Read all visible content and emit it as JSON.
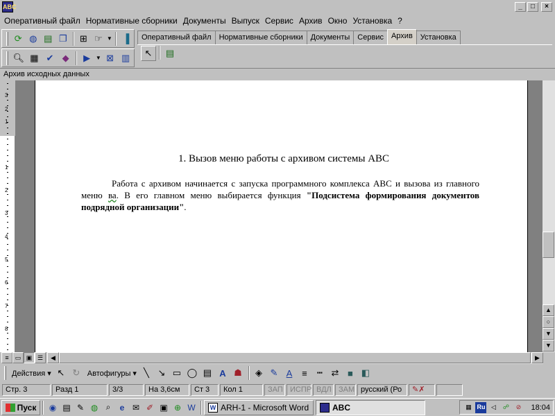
{
  "window": {
    "app_icon": "abc-app-icon",
    "minimize": "_",
    "maximize": "□",
    "close": "×"
  },
  "menu": [
    "Оперативный файл",
    "Нормативные сборники",
    "Документы",
    "Выпуск",
    "Сервис",
    "Архив",
    "Окно",
    "Установка",
    "?"
  ],
  "toolbar1_icons": [
    "refresh-icon",
    "globe-icon",
    "database-icon",
    "copy-icon",
    "tree-icon",
    "hand-icon",
    "door-exit-icon"
  ],
  "toolbar2_icons": [
    "preview-icon",
    "grid-icon",
    "checkmark-icon",
    "book-icon",
    "play-icon",
    "x-box-icon",
    "chart-icon"
  ],
  "tabs": [
    "Оперативный файл",
    "Нормативные сборники",
    "Документы",
    "Сервис",
    "Архив",
    "Установка"
  ],
  "active_tab": "Архив",
  "doc_bar_title": "Архив исходных данных",
  "ruler_numbers": [
    "3",
    "2",
    "1",
    "1",
    "2",
    "3",
    "4",
    "5",
    "6",
    "7",
    "8"
  ],
  "document": {
    "heading": "1. Вызов меню работы с архивом системы ABC",
    "para_part1": "Работа с архивом начинается с запуска программного комплекса ABC и вызова из главного меню ",
    "para_wavy": "ва",
    "para_part2": ". В его главном меню выбирается функция ",
    "para_bold": "\"Подсистема формирования документов подрядной организации\"",
    "para_end": "."
  },
  "drawbar": {
    "actions": "Действия",
    "autoshapes": "Автофигуры"
  },
  "status": {
    "page": "Стр. 3",
    "section": "Разд 1",
    "pages": "3/3",
    "at": "На 3,6см",
    "line": "Ст 3",
    "col": "Кол 1",
    "rec": "ЗАП",
    "trk": "ИСПР",
    "ext": "ВДЛ",
    "ovr": "ЗАМ",
    "lang": "русский (Ро"
  },
  "taskbar": {
    "start": "Пуск",
    "tasks": [
      {
        "label": "ARH-1 - Microsoft Word",
        "icon": "W"
      },
      {
        "label": "ABC",
        "icon": "abc"
      }
    ],
    "lang": "Ru",
    "clock": "18:04"
  },
  "colors": {
    "face": "#c0c0c0",
    "workspace": "#808080",
    "page": "#ffffff",
    "accent": "#1a3b9c"
  }
}
